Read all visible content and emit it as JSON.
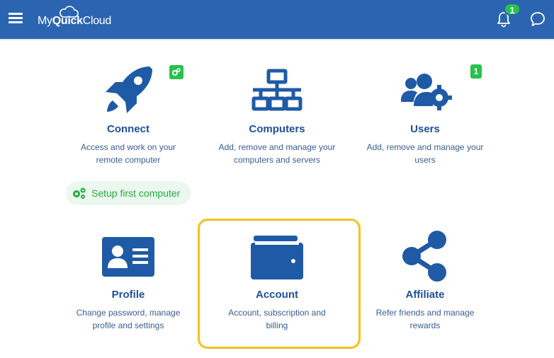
{
  "header": {
    "logo_my": "My",
    "logo_quick": "Quick",
    "logo_cloud": "Cloud",
    "notifications_count": "1"
  },
  "tiles": [
    {
      "title": "Connect",
      "desc_line1": "Access and work on your",
      "desc_line2": "remote computer",
      "icon": "rocket-icon"
    },
    {
      "title": "Computers",
      "desc_line1": "Add, remove and manage your",
      "desc_line2": "computers and servers",
      "icon": "network-icon"
    },
    {
      "title": "Users",
      "desc_line1": "Add, remove and manage your",
      "desc_line2": "users",
      "icon": "users-gear-icon",
      "badge": "1"
    },
    {
      "title": "Profile",
      "desc_line1": "Change password, manage",
      "desc_line2": "profile and settings",
      "icon": "id-card-icon"
    },
    {
      "title": "Account",
      "desc_line1": "Account, subscription and",
      "desc_line2": "billing",
      "icon": "wallet-icon"
    },
    {
      "title": "Affiliate",
      "desc_line1": "Refer friends and manage",
      "desc_line2": "rewards",
      "icon": "share-icon"
    }
  ],
  "setup_button": {
    "label": "Setup first computer",
    "icon": "gears-icon"
  },
  "colors": {
    "header_bg": "#2b65b1",
    "icon_blue": "#1f5aa6",
    "green": "#27c24c",
    "highlight": "#f2c21b"
  }
}
